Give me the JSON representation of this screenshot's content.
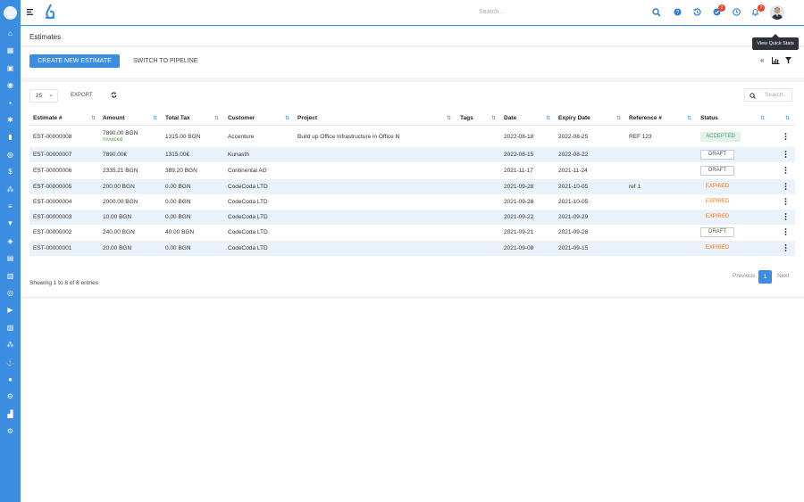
{
  "search": {
    "placeholder": "Search..."
  },
  "topbar": {
    "badges": {
      "tasks": "2",
      "notifications": "7"
    }
  },
  "page": {
    "title": "Estimates"
  },
  "tooltip": {
    "text": "View Quick Stats"
  },
  "actions": {
    "create_label": "CREATE NEW ESTIMATE",
    "switch_label": "SWITCH TO PIPELINE"
  },
  "controls": {
    "page_length": "25",
    "export_label": "EXPORT",
    "search_placeholder": "Search..."
  },
  "table": {
    "headers": [
      "Estimate #",
      "Amount",
      "Total Tax",
      "Customer",
      "Project",
      "Tags",
      "Date",
      "Expiry Date",
      "Reference #",
      "Status"
    ],
    "rows": [
      {
        "number": "EST-00000008",
        "amount": "7890.00 BGN",
        "amount_sub": "Invoiced",
        "tax": "1315.00 BGN",
        "customer": "Accenture",
        "project": "Build up Office Infrastructure in Office N",
        "tags": "",
        "date": "2022-08-18",
        "expiry": "2022-08-25",
        "ref": "REF 123",
        "status": "ACCEPTED",
        "status_kind": "accepted"
      },
      {
        "number": "EST-00000007",
        "amount": "7890.00€",
        "amount_sub": "",
        "tax": "1315.00€",
        "customer": "Kunasth",
        "project": "",
        "tags": "",
        "date": "2022-08-15",
        "expiry": "2022-08-22",
        "ref": "",
        "status": "DRAFT",
        "status_kind": "draft"
      },
      {
        "number": "EST-00000006",
        "amount": "2335.21 BGN",
        "amount_sub": "",
        "tax": "389.20 BGN",
        "customer": "Continental AG",
        "project": "",
        "tags": "",
        "date": "2021-11-17",
        "expiry": "2021-11-24",
        "ref": "",
        "status": "DRAFT",
        "status_kind": "draft"
      },
      {
        "number": "EST-00000005",
        "amount": "200.00 BGN",
        "amount_sub": "",
        "tax": "0.00 BGN",
        "customer": "CodeCoda LTD",
        "project": "",
        "tags": "",
        "date": "2021-09-28",
        "expiry": "2021-10-05",
        "ref": "ref 1",
        "status": "EXPIRED",
        "status_kind": "expired"
      },
      {
        "number": "EST-00000004",
        "amount": "2000.00 BGN",
        "amount_sub": "",
        "tax": "0.00 BGN",
        "customer": "CodeCoda LTD",
        "project": "",
        "tags": "",
        "date": "2021-09-28",
        "expiry": "2021-10-05",
        "ref": "",
        "status": "EXPIRED",
        "status_kind": "expired"
      },
      {
        "number": "EST-00000003",
        "amount": "10.00 BGN",
        "amount_sub": "",
        "tax": "0.00 BGN",
        "customer": "CodeCoda LTD",
        "project": "",
        "tags": "",
        "date": "2021-09-22",
        "expiry": "2021-09-29",
        "ref": "",
        "status": "EXPIRED",
        "status_kind": "expired"
      },
      {
        "number": "EST-00000002",
        "amount": "240.00 BGN",
        "amount_sub": "",
        "tax": "40.00 BGN",
        "customer": "CodeCoda LTD",
        "project": "",
        "tags": "",
        "date": "2021-09-21",
        "expiry": "2021-09-28",
        "ref": "",
        "status": "DRAFT",
        "status_kind": "draft"
      },
      {
        "number": "EST-00000001",
        "amount": "20.00 BGN",
        "amount_sub": "",
        "tax": "0.00 BGN",
        "customer": "CodeCoda LTD",
        "project": "",
        "tags": "",
        "date": "2021-09-08",
        "expiry": "2021-09-15",
        "ref": "",
        "status": "EXPIRED",
        "status_kind": "expired"
      }
    ]
  },
  "footer": {
    "info": "Showing 1 to 8 of 8 entries",
    "prev_label": "Previous",
    "current_page": "1",
    "next_label": "Next"
  },
  "colors": {
    "primary": "#3b8de2",
    "accepted": "#37a66a",
    "expired": "#f07a2a",
    "badge": "#e8452c"
  },
  "icons": [
    "home-icon",
    "dashboard-icon",
    "calendar-icon",
    "user-icon",
    "cart-icon",
    "support-icon",
    "chart-icon",
    "globe-icon",
    "dollar-icon",
    "team-icon",
    "list-icon",
    "filter-icon",
    "handshake-icon",
    "report-icon",
    "schedule-icon",
    "help-icon",
    "video-icon",
    "contact-icon",
    "groups-icon",
    "anchor-icon",
    "location-icon",
    "cogs-icon",
    "factory-icon",
    "settings-icon"
  ]
}
